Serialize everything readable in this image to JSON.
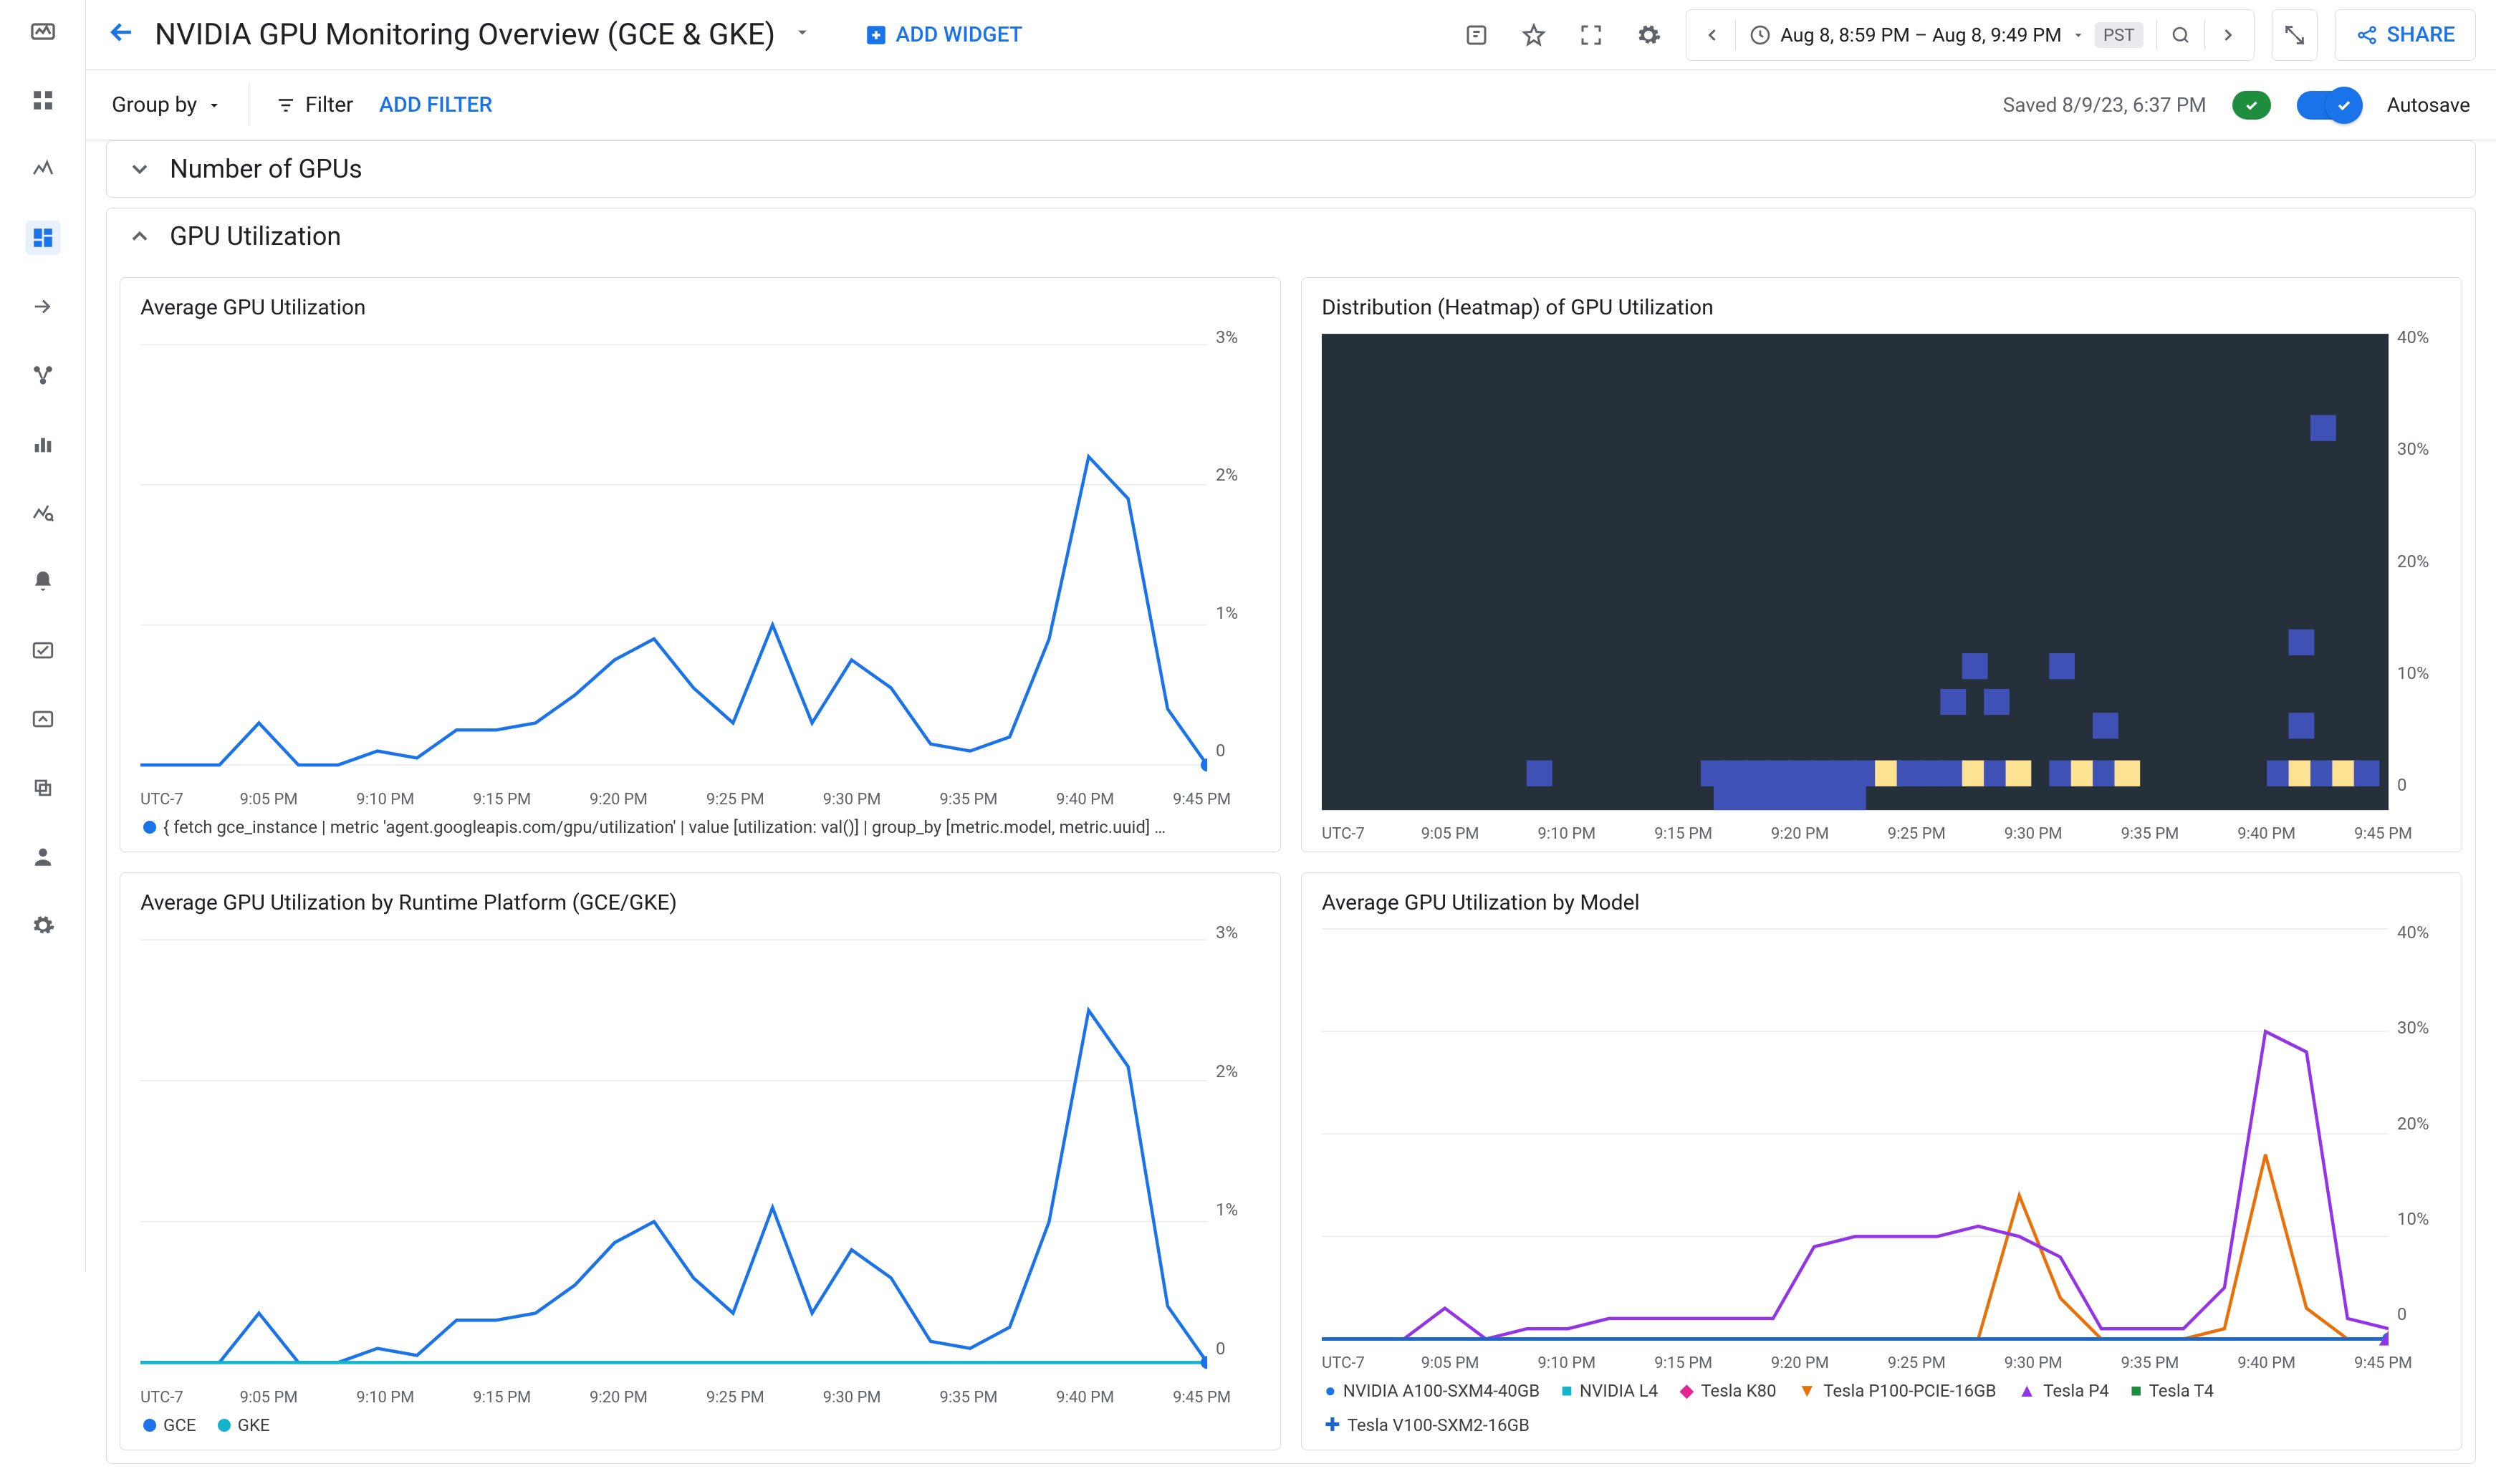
{
  "header": {
    "title": "NVIDIA GPU Monitoring Overview (GCE & GKE)",
    "add_widget": "ADD WIDGET",
    "time_range": "Aug 8, 8:59 PM – Aug 8, 9:49 PM",
    "tz_badge": "PST",
    "share": "SHARE"
  },
  "subheader": {
    "group_by": "Group by",
    "filter": "Filter",
    "add_filter": "ADD FILTER",
    "saved": "Saved 8/9/23, 6:37 PM",
    "autosave": "Autosave"
  },
  "sections": {
    "gpus": "Number of GPUs",
    "util": "GPU Utilization"
  },
  "cards": {
    "avg": "Average GPU Utilization",
    "heat": "Distribution (Heatmap) of GPU Utilization",
    "plat": "Average GPU Utilization by Runtime Platform (GCE/GKE)",
    "model": "Average GPU Utilization by Model"
  },
  "legends": {
    "avg": "{ fetch gce_instance | metric 'agent.googleapis.com/gpu/utilization' | value [utilization: val()] | group_by [metric.model, metric.uuid] | ma...",
    "plat": [
      "GCE",
      "GKE"
    ],
    "model": [
      "NVIDIA A100-SXM4-40GB",
      "NVIDIA L4",
      "Tesla K80",
      "Tesla P100-PCIE-16GB",
      "Tesla P4",
      "Tesla T4",
      "Tesla V100-SXM2-16GB"
    ]
  },
  "axes": {
    "x": [
      "UTC-7",
      "9:05 PM",
      "9:10 PM",
      "9:15 PM",
      "9:20 PM",
      "9:25 PM",
      "9:30 PM",
      "9:35 PM",
      "9:40 PM",
      "9:45 PM"
    ],
    "pct3": [
      "3%",
      "2%",
      "1%",
      "0"
    ],
    "pct40": [
      "40%",
      "30%",
      "20%",
      "10%",
      "0"
    ]
  },
  "colors": {
    "blue": "#1a73e8",
    "teal": "#12b5cb",
    "magenta": "#e52592",
    "orange": "#e8710a",
    "purple": "#9334e6",
    "green": "#1e8e3e",
    "darkblue": "#1967d2",
    "yellow": "#fde293",
    "heatblue": "#3f51b5"
  },
  "chart_data": [
    {
      "id": "avg_gpu_util",
      "type": "line",
      "title": "Average GPU Utilization",
      "xlabel": "",
      "ylabel": "",
      "ylim": [
        0,
        3
      ],
      "categories": [
        "9:00",
        "9:05",
        "9:10",
        "9:11",
        "9:12",
        "9:15",
        "9:18",
        "9:20",
        "9:22",
        "9:25",
        "9:27",
        "9:29",
        "9:30",
        "9:31",
        "9:32",
        "9:34",
        "9:35",
        "9:36",
        "9:37",
        "9:38",
        "9:39",
        "9:40",
        "9:43",
        "9:45",
        "9:46",
        "9:47",
        "9:48",
        "9:49"
      ],
      "series": [
        {
          "name": "utilization",
          "color": "#1a73e8",
          "values": [
            0,
            0,
            0,
            0.3,
            0,
            0,
            0.1,
            0.05,
            0.25,
            0.25,
            0.3,
            0.5,
            0.75,
            0.9,
            0.55,
            0.3,
            1.0,
            0.3,
            0.75,
            0.55,
            0.15,
            0.1,
            0.2,
            0.9,
            2.2,
            1.9,
            0.4,
            0
          ]
        }
      ]
    },
    {
      "id": "heatmap_gpu_util",
      "type": "heatmap",
      "title": "Distribution (Heatmap) of GPU Utilization",
      "xlabel": "",
      "ylabel": "",
      "ylim": [
        0,
        40
      ],
      "x": [
        "9:10",
        "9:18",
        "9:19",
        "9:20",
        "9:21",
        "9:22",
        "9:23",
        "9:24",
        "9:25",
        "9:26",
        "9:27",
        "9:28",
        "9:29",
        "9:30",
        "9:31",
        "9:32",
        "9:34",
        "9:35",
        "9:36",
        "9:37",
        "9:44",
        "9:45",
        "9:46",
        "9:47",
        "9:48"
      ],
      "cells": [
        {
          "x": "9:10",
          "y": 2,
          "c": "band"
        },
        {
          "x": "9:18",
          "y": 2,
          "c": "band"
        },
        {
          "x": "9:19",
          "y": 2,
          "c": "band"
        },
        {
          "x": "9:20",
          "y": 2,
          "c": "band"
        },
        {
          "x": "9:21",
          "y": 2,
          "c": "band"
        },
        {
          "x": "9:22",
          "y": 2,
          "c": "band"
        },
        {
          "x": "9:23",
          "y": 2,
          "c": "band"
        },
        {
          "x": "9:24",
          "y": 2,
          "c": "band"
        },
        {
          "x": "9:25",
          "y": 2,
          "c": "band"
        },
        {
          "x": "9:26",
          "y": 2,
          "c": "yellow"
        },
        {
          "x": "9:27",
          "y": 2,
          "c": "band"
        },
        {
          "x": "9:28",
          "y": 2,
          "c": "band"
        },
        {
          "x": "9:29",
          "y": 2,
          "c": "band"
        },
        {
          "x": "9:29",
          "y": 8,
          "c": "blue"
        },
        {
          "x": "9:30",
          "y": 2,
          "c": "yellow"
        },
        {
          "x": "9:30",
          "y": 11,
          "c": "blue"
        },
        {
          "x": "9:31",
          "y": 2,
          "c": "band"
        },
        {
          "x": "9:31",
          "y": 8,
          "c": "blue"
        },
        {
          "x": "9:32",
          "y": 2,
          "c": "yellow"
        },
        {
          "x": "9:34",
          "y": 2,
          "c": "band"
        },
        {
          "x": "9:34",
          "y": 11,
          "c": "blue"
        },
        {
          "x": "9:35",
          "y": 2,
          "c": "yellow"
        },
        {
          "x": "9:36",
          "y": 2,
          "c": "band"
        },
        {
          "x": "9:36",
          "y": 6,
          "c": "blue"
        },
        {
          "x": "9:37",
          "y": 2,
          "c": "yellow"
        },
        {
          "x": "9:44",
          "y": 2,
          "c": "band"
        },
        {
          "x": "9:45",
          "y": 2,
          "c": "yellow"
        },
        {
          "x": "9:45",
          "y": 6,
          "c": "blue"
        },
        {
          "x": "9:45",
          "y": 13,
          "c": "blue"
        },
        {
          "x": "9:46",
          "y": 2,
          "c": "band"
        },
        {
          "x": "9:46",
          "y": 31,
          "c": "blue"
        },
        {
          "x": "9:47",
          "y": 2,
          "c": "yellow"
        },
        {
          "x": "9:48",
          "y": 2,
          "c": "band"
        }
      ]
    },
    {
      "id": "avg_by_platform",
      "type": "line",
      "title": "Average GPU Utilization by Runtime Platform (GCE/GKE)",
      "xlabel": "",
      "ylabel": "",
      "ylim": [
        0,
        3
      ],
      "categories": [
        "9:00",
        "9:05",
        "9:10",
        "9:11",
        "9:12",
        "9:15",
        "9:18",
        "9:20",
        "9:22",
        "9:25",
        "9:27",
        "9:29",
        "9:30",
        "9:31",
        "9:32",
        "9:34",
        "9:35",
        "9:36",
        "9:37",
        "9:38",
        "9:39",
        "9:40",
        "9:43",
        "9:45",
        "9:46",
        "9:47",
        "9:48",
        "9:49"
      ],
      "series": [
        {
          "name": "GCE",
          "color": "#1a73e8",
          "values": [
            0,
            0,
            0,
            0.35,
            0,
            0,
            0.1,
            0.05,
            0.3,
            0.3,
            0.35,
            0.55,
            0.85,
            1.0,
            0.6,
            0.35,
            1.1,
            0.35,
            0.8,
            0.6,
            0.15,
            0.1,
            0.25,
            1.0,
            2.5,
            2.1,
            0.4,
            0
          ]
        },
        {
          "name": "GKE",
          "color": "#12b5cb",
          "values": [
            0,
            0,
            0,
            0,
            0,
            0,
            0,
            0,
            0,
            0,
            0,
            0,
            0,
            0,
            0,
            0,
            0,
            0,
            0,
            0,
            0,
            0,
            0,
            0,
            0,
            0,
            0,
            0
          ]
        }
      ]
    },
    {
      "id": "avg_by_model",
      "type": "line",
      "title": "Average GPU Utilization by Model",
      "xlabel": "",
      "ylabel": "",
      "ylim": [
        0,
        40
      ],
      "categories": [
        "9:00",
        "9:05",
        "9:10",
        "9:11",
        "9:12",
        "9:15",
        "9:18",
        "9:20",
        "9:22",
        "9:25",
        "9:27",
        "9:29",
        "9:30",
        "9:31",
        "9:32",
        "9:34",
        "9:35",
        "9:36",
        "9:37",
        "9:38",
        "9:40",
        "9:43",
        "9:45",
        "9:46",
        "9:47",
        "9:48",
        "9:49"
      ],
      "series": [
        {
          "name": "NVIDIA A100-SXM4-40GB",
          "color": "#1a73e8",
          "values": [
            0,
            0,
            0,
            0,
            0,
            0,
            0,
            0,
            0,
            0,
            0,
            0,
            0,
            0,
            0,
            0,
            0,
            0,
            0,
            0,
            0,
            0,
            0,
            0,
            0,
            0,
            0
          ]
        },
        {
          "name": "NVIDIA L4",
          "color": "#12b5cb",
          "values": [
            0,
            0,
            0,
            0,
            0,
            0,
            0,
            0,
            0,
            0,
            0,
            0,
            0,
            0,
            0,
            0,
            0,
            0,
            0,
            0,
            0,
            0,
            0,
            0,
            0,
            0,
            0
          ]
        },
        {
          "name": "Tesla K80",
          "color": "#e52592",
          "values": [
            0,
            0,
            0,
            0,
            0,
            0,
            0,
            0,
            0,
            0,
            0,
            0,
            0,
            0,
            0,
            0,
            0,
            0,
            0,
            0,
            0,
            0,
            0,
            0,
            0,
            0,
            0
          ]
        },
        {
          "name": "Tesla P100-PCIE-16GB",
          "color": "#e8710a",
          "values": [
            0,
            0,
            0,
            0,
            0,
            0,
            0,
            0,
            0,
            0,
            0,
            0,
            0,
            0,
            0,
            0,
            0,
            14,
            4,
            0,
            0,
            0,
            1,
            18,
            3,
            0,
            0
          ]
        },
        {
          "name": "Tesla P4",
          "color": "#9334e6",
          "values": [
            0,
            0,
            0,
            3,
            0,
            1,
            1,
            2,
            2,
            2,
            2,
            2,
            9,
            10,
            10,
            10,
            11,
            10,
            8,
            1,
            1,
            1,
            5,
            30,
            28,
            2,
            1
          ]
        },
        {
          "name": "Tesla T4",
          "color": "#1e8e3e",
          "values": [
            0,
            0,
            0,
            0,
            0,
            0,
            0,
            0,
            0,
            0,
            0,
            0,
            0,
            0,
            0,
            0,
            0,
            0,
            0,
            0,
            0,
            0,
            0,
            0,
            0,
            0,
            0
          ]
        },
        {
          "name": "Tesla V100-SXM2-16GB",
          "color": "#1967d2",
          "values": [
            0,
            0,
            0,
            0,
            0,
            0,
            0,
            0,
            0,
            0,
            0,
            0,
            0,
            0,
            0,
            0,
            0,
            0,
            0,
            0,
            0,
            0,
            0,
            0,
            0,
            0,
            0
          ]
        }
      ]
    }
  ]
}
